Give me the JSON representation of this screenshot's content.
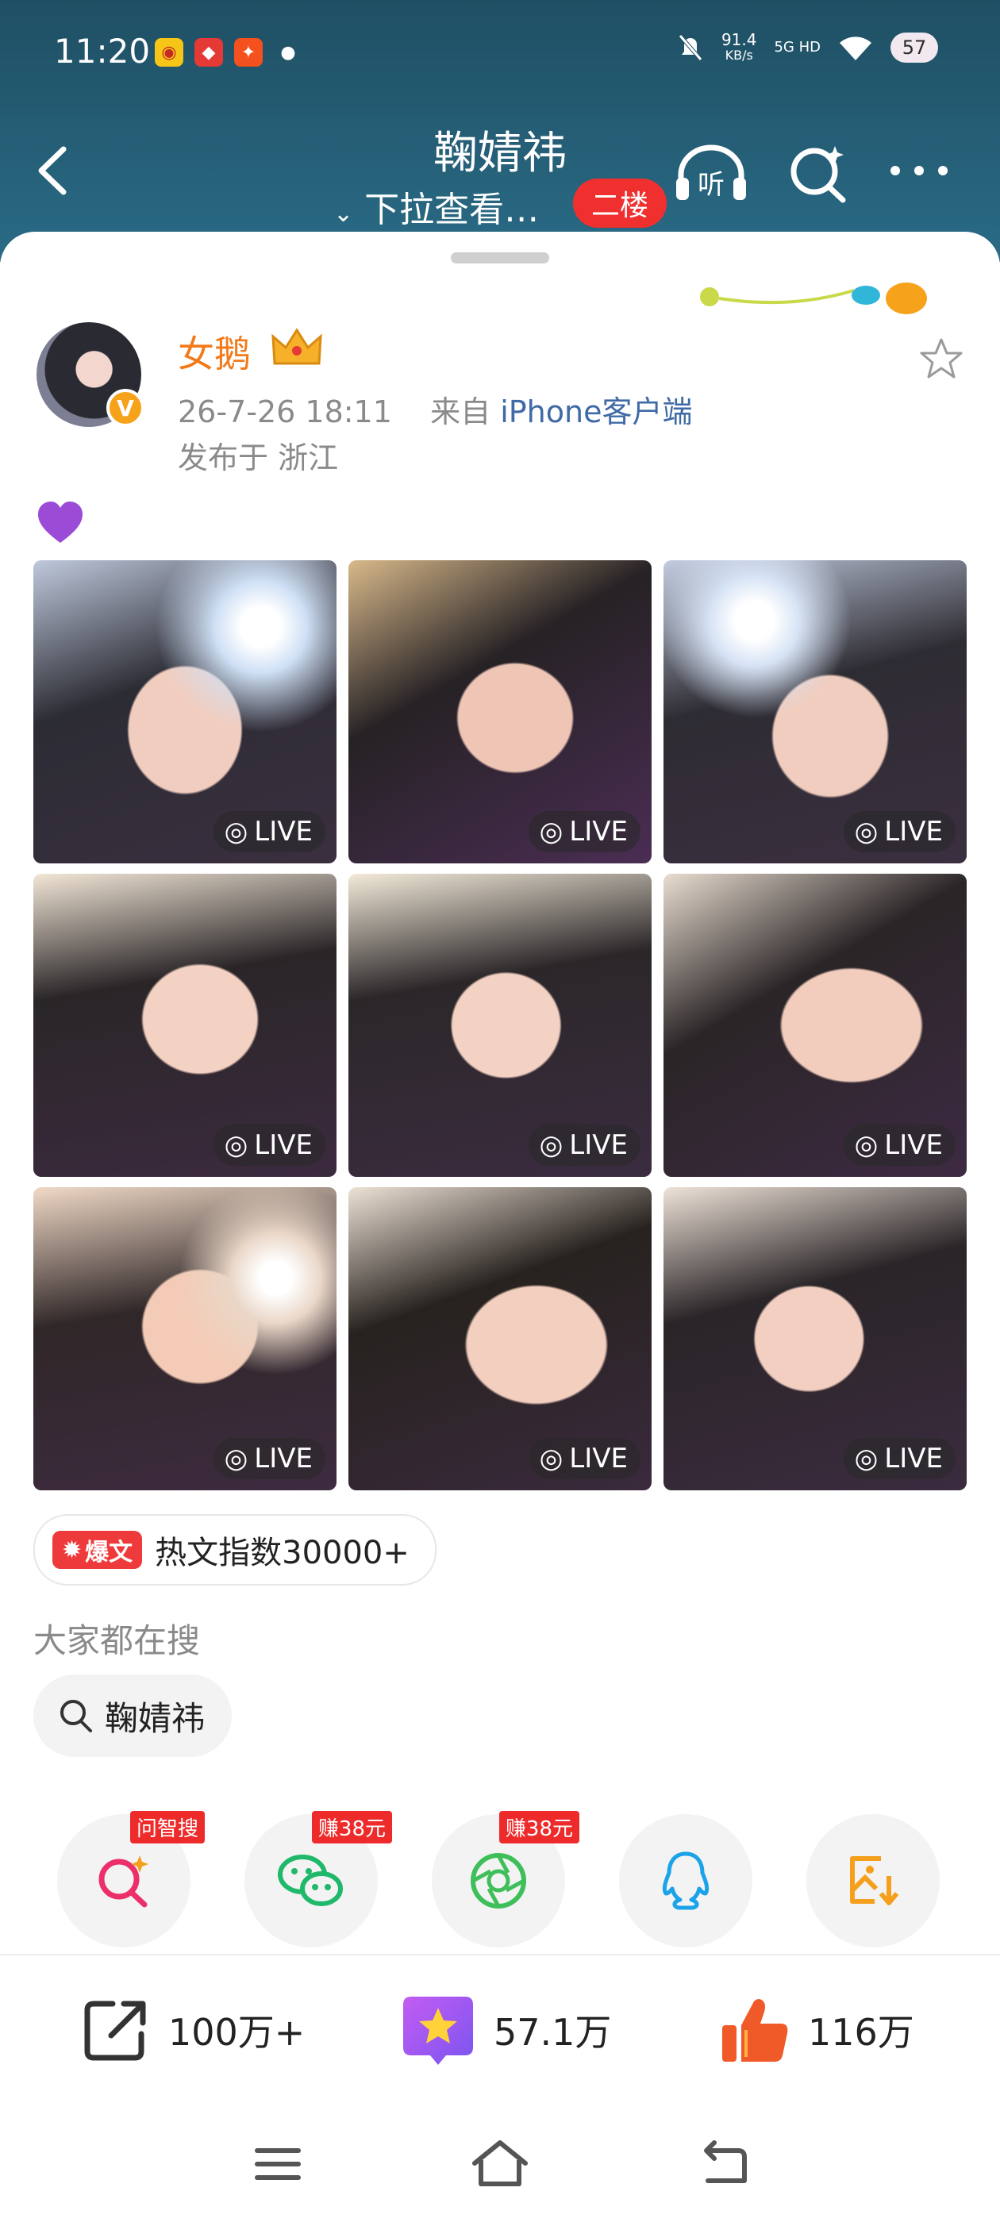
{
  "status_bar": {
    "time": "11:20",
    "net_speed_value": "91.4",
    "net_speed_unit": "KB/s",
    "network": "5G HD",
    "battery": "57"
  },
  "nav": {
    "title": "鞠婧祎",
    "subtitle": "下拉查看…",
    "floor_badge": "二楼",
    "listen_label": "听"
  },
  "post": {
    "author": "女鹅",
    "date": "26-7-26 18:11",
    "from_prefix": "来自",
    "source": "iPhone客户端",
    "location": "发布于 浙江",
    "emoji": "💜",
    "verified_glyph": "V",
    "images": [
      {
        "live_label": "LIVE"
      },
      {
        "live_label": "LIVE"
      },
      {
        "live_label": "LIVE"
      },
      {
        "live_label": "LIVE"
      },
      {
        "live_label": "LIVE"
      },
      {
        "live_label": "LIVE"
      },
      {
        "live_label": "LIVE"
      },
      {
        "live_label": "LIVE"
      },
      {
        "live_label": "LIVE"
      }
    ],
    "hot_tag": "爆文",
    "hot_text": "热文指数30000+"
  },
  "search": {
    "title": "大家都在搜",
    "chip": "鞠婧祎"
  },
  "share": {
    "items": [
      {
        "icon": "ai-search-icon",
        "tag": "问智搜"
      },
      {
        "icon": "wechat-icon",
        "tag": "赚38元"
      },
      {
        "icon": "moments-icon",
        "tag": "赚38元"
      },
      {
        "icon": "qq-icon",
        "tag": ""
      },
      {
        "icon": "save-image-icon",
        "tag": ""
      }
    ]
  },
  "actions": {
    "repost": "100万+",
    "favorite": "57.1万",
    "like": "116万"
  },
  "colors": {
    "header": "#1f4f63",
    "author": "#f27a1a",
    "source_link": "#3f6aa6",
    "badge_red": "#ee3a3a"
  }
}
